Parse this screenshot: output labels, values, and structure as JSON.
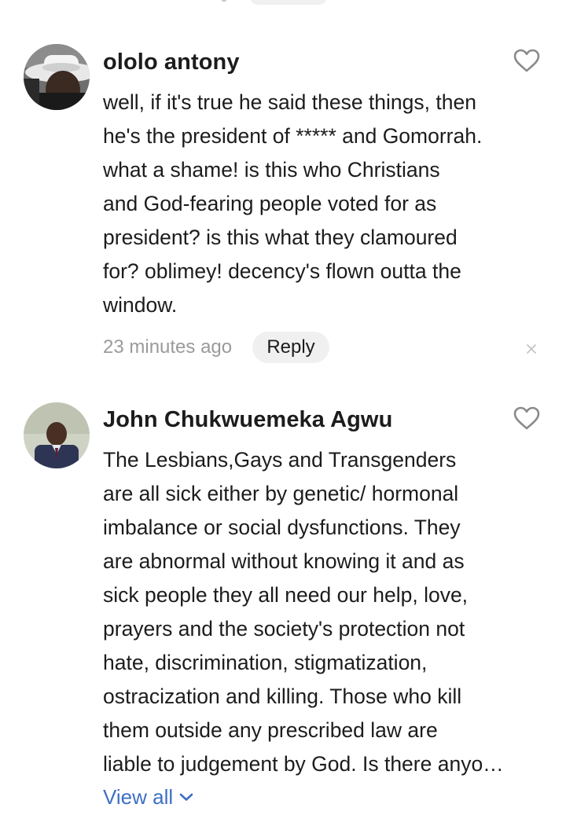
{
  "comments": [
    {
      "author": "ololo antony",
      "avatar_icon": "user-avatar-white-hat",
      "text_lines": [
        "well, if it's true he said these things, then",
        "he's the president of ***** and Gomorrah.",
        "what a shame! is this who Christians",
        "and God-fearing people voted for as",
        "president? is this what they clamoured",
        "for? oblimey! decency's flown outta the",
        "window."
      ],
      "time": "23 minutes ago",
      "reply_label": "Reply",
      "like_icon": "heart-outline-icon",
      "dismiss_icon": "close-icon"
    },
    {
      "author": "John Chukwuemeka Agwu",
      "avatar_icon": "user-avatar-photo",
      "text_lines": [
        "The Lesbians,Gays and Transgenders",
        "are all sick either by genetic/ hormonal",
        "imbalance or social dysfunctions. They",
        "are abnormal without knowing it and as",
        "sick people they all need our help, love,",
        "prayers and the society's protection not",
        "hate, discrimination, stigmatization,",
        "ostracization and killing. Those who kill",
        "them outside any prescribed law  are",
        "liable to judgement by God. Is there anyo…"
      ],
      "view_all_label": "View all",
      "like_icon": "heart-outline-icon",
      "expand_icon": "chevron-down-icon"
    }
  ],
  "colors": {
    "text": "#1c1c1c",
    "meta": "#9a9a9a",
    "link": "#3d6fc4",
    "pill_bg": "#f0f0f0",
    "icon": "#8a8a8a"
  }
}
